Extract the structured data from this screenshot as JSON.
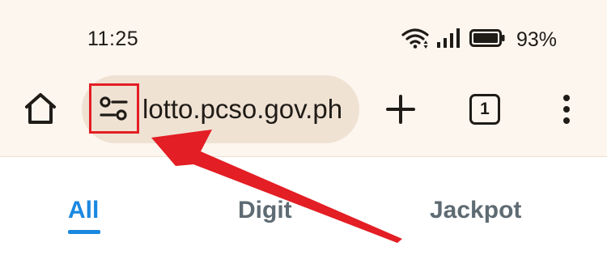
{
  "status_bar": {
    "time": "11:25",
    "battery_percent": "93%",
    "icons": [
      "wifi-icon",
      "signal-icon",
      "battery-icon"
    ]
  },
  "toolbar": {
    "url": "lotto.pcso.gov.ph",
    "tab_count": "1",
    "icons": [
      "home-icon",
      "tune-icon",
      "plus-icon",
      "tab-switcher-icon",
      "more-vert-icon"
    ]
  },
  "page_tabs": {
    "items": [
      {
        "label": "All",
        "active": true
      },
      {
        "label": "Digit",
        "active": false
      },
      {
        "label": "Jackpot",
        "active": false
      }
    ]
  },
  "annotation": {
    "highlight_color": "#e31e24",
    "accent_color": "#1a88e0"
  }
}
